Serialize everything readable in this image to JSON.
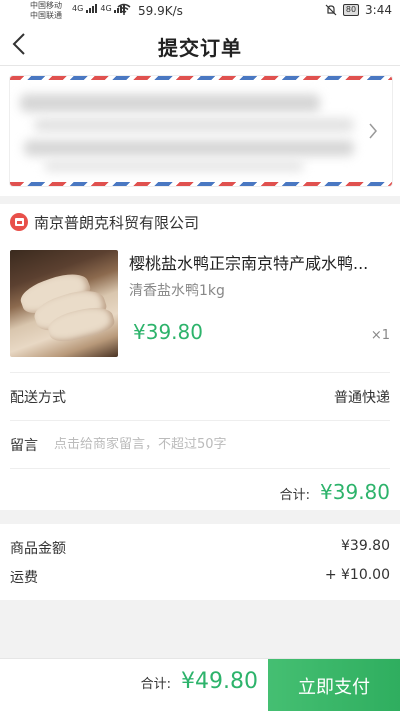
{
  "status_bar": {
    "carrier_1": "中国移动",
    "carrier_2": "中国联通",
    "net_1": "4G",
    "net_2": "4G",
    "speed": "59.9K/s",
    "battery": "80",
    "time": "3:44",
    "icons": [
      "signal-icon",
      "wifi-icon",
      "mute-icon",
      "battery-icon"
    ]
  },
  "nav": {
    "title": "提交订单",
    "back_icon": "chevron-left-icon"
  },
  "address": {
    "chevron_icon": "chevron-right-icon"
  },
  "shop": {
    "name": "南京普朗克科贸有限公司",
    "icon": "store-icon"
  },
  "product": {
    "title": "樱桃盐水鸭正宗南京特产咸水鸭...",
    "spec": "清香盐水鸭1kg",
    "price": "¥39.80",
    "qty": "×1"
  },
  "delivery": {
    "label": "配送方式",
    "value": "普通快递"
  },
  "message": {
    "label": "留言",
    "placeholder": "点击给商家留言，不超过50字"
  },
  "shop_subtotal": {
    "label": "合计:",
    "value": "¥39.80"
  },
  "fees": {
    "goods_label": "商品金额",
    "goods_value": "¥39.80",
    "shipping_label": "运费",
    "shipping_value": "+ ¥10.00"
  },
  "footer": {
    "total_label": "合计:",
    "total_value": "¥49.80",
    "pay_label": "立即支付"
  },
  "colors": {
    "accent_green": "#2db36b",
    "shop_red": "#e8504a"
  }
}
